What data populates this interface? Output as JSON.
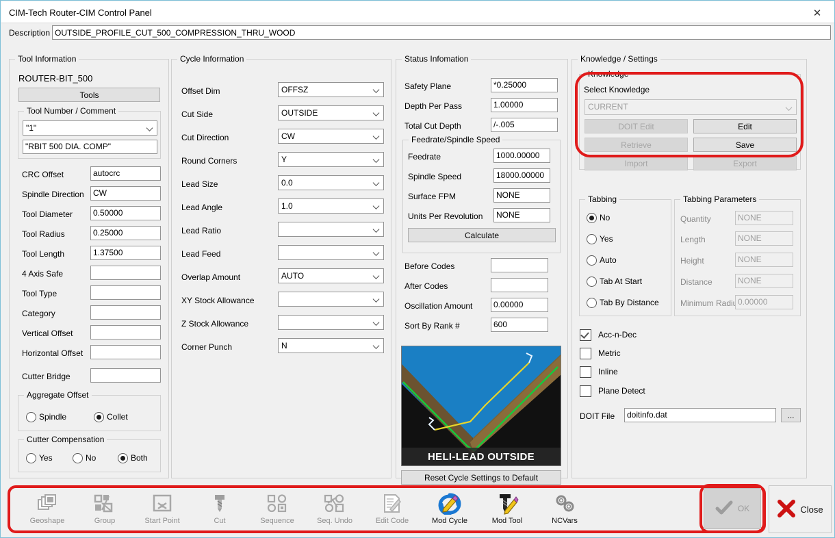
{
  "window": {
    "title": "CIM-Tech Router-CIM Control Panel",
    "close_icon": "close-icon"
  },
  "description": {
    "label": "Description",
    "value": "OUTSIDE_PROFILE_CUT_500_COMPRESSION_THRU_WOOD",
    "placeholder": ""
  },
  "tool_information": {
    "group_title": "Tool Information",
    "tool_name": "ROUTER-BIT_500",
    "tools_button": "Tools",
    "tool_number_group": "Tool Number / Comment",
    "tool_number": "\"1\"",
    "tool_comment": "\"RBIT 500 DIA. COMP\"",
    "fields": [
      {
        "label": "CRC Offset",
        "value": "autocrc"
      },
      {
        "label": "Spindle Direction",
        "value": "CW"
      },
      {
        "label": "Tool Diameter",
        "value": "0.50000"
      },
      {
        "label": "Tool Radius",
        "value": "0.25000"
      },
      {
        "label": "Tool Length",
        "value": "1.37500"
      },
      {
        "label": "4 Axis Safe",
        "value": ""
      },
      {
        "label": "Tool Type",
        "value": ""
      },
      {
        "label": "Category",
        "value": ""
      },
      {
        "label": "Vertical Offset",
        "value": ""
      },
      {
        "label": "Horizontal Offset",
        "value": ""
      },
      {
        "label": "Cutter Bridge",
        "value": ""
      }
    ],
    "aggregate_offset": {
      "group_title": "Aggregate Offset",
      "options": [
        {
          "label": "Spindle",
          "selected": false
        },
        {
          "label": "Collet",
          "selected": true
        }
      ]
    },
    "cutter_compensation": {
      "group_title": "Cutter Compensation",
      "options": [
        {
          "label": "Yes",
          "selected": false
        },
        {
          "label": "No",
          "selected": false
        },
        {
          "label": "Both",
          "selected": true
        }
      ]
    }
  },
  "cycle_information": {
    "group_title": "Cycle Information",
    "fields": [
      {
        "label": "Offset Dim",
        "value": "OFFSZ"
      },
      {
        "label": "Cut Side",
        "value": "OUTSIDE"
      },
      {
        "label": "Cut Direction",
        "value": "CW"
      },
      {
        "label": "Round Corners",
        "value": "Y"
      },
      {
        "label": "Lead Size",
        "value": "0.0"
      },
      {
        "label": "Lead Angle",
        "value": "1.0"
      },
      {
        "label": "Lead Ratio",
        "value": ""
      },
      {
        "label": "Lead Feed",
        "value": ""
      },
      {
        "label": "Overlap Amount",
        "value": "AUTO"
      },
      {
        "label": "XY Stock Allowance",
        "value": ""
      },
      {
        "label": "Z Stock Allowance",
        "value": ""
      },
      {
        "label": "Corner Punch",
        "value": "N"
      }
    ]
  },
  "status_information": {
    "group_title": "Status Infomation",
    "fields": [
      {
        "label": "Safety Plane",
        "value": "*0.25000"
      },
      {
        "label": "Depth Per Pass",
        "value": "1.00000"
      },
      {
        "label": "Total Cut Depth",
        "value": "/-.005"
      }
    ],
    "feedrate_group": {
      "group_title": "Feedrate/Spindle Speed",
      "fields": [
        {
          "label": "Feedrate",
          "value": "1000.00000"
        },
        {
          "label": "Spindle Speed",
          "value": "18000.00000"
        },
        {
          "label": "Surface FPM",
          "value": "NONE"
        },
        {
          "label": "Units Per Revolution",
          "value": "NONE"
        }
      ],
      "calculate_button": "Calculate"
    },
    "codes": [
      {
        "label": "Before Codes",
        "value": ""
      },
      {
        "label": "After Codes",
        "value": ""
      },
      {
        "label": "Oscillation Amount",
        "value": "0.00000"
      },
      {
        "label": "Sort By Rank #",
        "value": "600"
      }
    ],
    "preview_caption": "HELI-LEAD OUTSIDE",
    "reset_button": "Reset Cycle Settings to Default"
  },
  "knowledge_settings": {
    "group_title": "Knowledge / Settings",
    "knowledge": {
      "group_title": "Knowledge",
      "select_label": "Select Knowledge",
      "selected": "CURRENT",
      "buttons": [
        {
          "label": "DOIT Edit",
          "disabled": true
        },
        {
          "label": "Edit",
          "disabled": false
        },
        {
          "label": "Retrieve",
          "disabled": true
        },
        {
          "label": "Save",
          "disabled": false
        },
        {
          "label": "Import",
          "disabled": true
        },
        {
          "label": "Export",
          "disabled": true
        }
      ]
    },
    "tabbing": {
      "group_title": "Tabbing",
      "options": [
        {
          "label": "No",
          "selected": true
        },
        {
          "label": "Yes",
          "selected": false
        },
        {
          "label": "Auto",
          "selected": false
        },
        {
          "label": "Tab At Start",
          "selected": false
        },
        {
          "label": "Tab By Distance",
          "selected": false
        }
      ]
    },
    "tabbing_parameters": {
      "group_title": "Tabbing Parameters",
      "fields": [
        {
          "label": "Quantity",
          "value": "NONE"
        },
        {
          "label": "Length",
          "value": "NONE"
        },
        {
          "label": "Height",
          "value": "NONE"
        },
        {
          "label": "Distance",
          "value": "NONE"
        },
        {
          "label": "Minimum Radius",
          "value": "0.00000"
        }
      ]
    },
    "checkboxes": [
      {
        "label": "Acc-n-Dec",
        "checked": true
      },
      {
        "label": "Metric",
        "checked": false
      },
      {
        "label": "Inline",
        "checked": false
      },
      {
        "label": "Plane Detect",
        "checked": false
      }
    ],
    "doit_file": {
      "label": "DOIT File",
      "value": "doitinfo.dat",
      "browse_button": "..."
    }
  },
  "toolbar": {
    "items": [
      {
        "label": "Geoshape",
        "icon": "geoshape-icon",
        "active": false
      },
      {
        "label": "Group",
        "icon": "group-icon",
        "active": false
      },
      {
        "label": "Start Point",
        "icon": "start-point-icon",
        "active": false
      },
      {
        "label": "Cut",
        "icon": "cut-icon",
        "active": false
      },
      {
        "label": "Sequence",
        "icon": "sequence-icon",
        "active": false
      },
      {
        "label": "Seq. Undo",
        "icon": "seq-undo-icon",
        "active": false
      },
      {
        "label": "Edit Code",
        "icon": "edit-code-icon",
        "active": false
      },
      {
        "label": "Mod Cycle",
        "icon": "mod-cycle-icon",
        "active": true
      },
      {
        "label": "Mod Tool",
        "icon": "mod-tool-icon",
        "active": true
      },
      {
        "label": "NCVars",
        "icon": "ncvars-icon",
        "active": true
      }
    ],
    "ok_button": {
      "label": "OK",
      "icon": "checkmark-icon"
    },
    "close_button": {
      "label": "Close",
      "icon": "red-x-icon"
    }
  },
  "colors": {
    "highlight": "#e01b1b",
    "window_border": "#7ec0d8",
    "panel_bg": "#f0f0f0"
  }
}
